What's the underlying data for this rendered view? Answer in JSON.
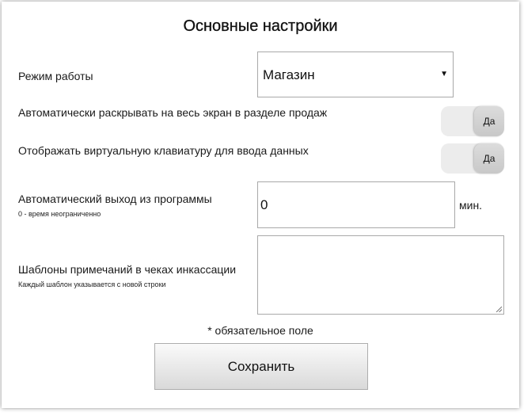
{
  "title": "Основные настройки",
  "mode": {
    "label": "Режим работы",
    "value": "Магазин",
    "arrow": "▼"
  },
  "fullscreen": {
    "label": "Автоматически раскрывать на весь экран в разделе продаж",
    "toggle_label": "Да",
    "enabled": true
  },
  "keyboard": {
    "label": "Отображать виртуальную клавиатуру для ввода данных",
    "toggle_label": "Да",
    "enabled": true
  },
  "auto_exit": {
    "label": "Автоматический выход из программы",
    "hint": "0 - время неограниченно",
    "value": "0",
    "unit": "мин."
  },
  "templates": {
    "label": "Шаблоны примечаний в чеках инкассации",
    "hint": "Каждый шаблон указывается с новой строки",
    "value": ""
  },
  "required_note": "* обязательное поле",
  "save_label": "Сохранить"
}
